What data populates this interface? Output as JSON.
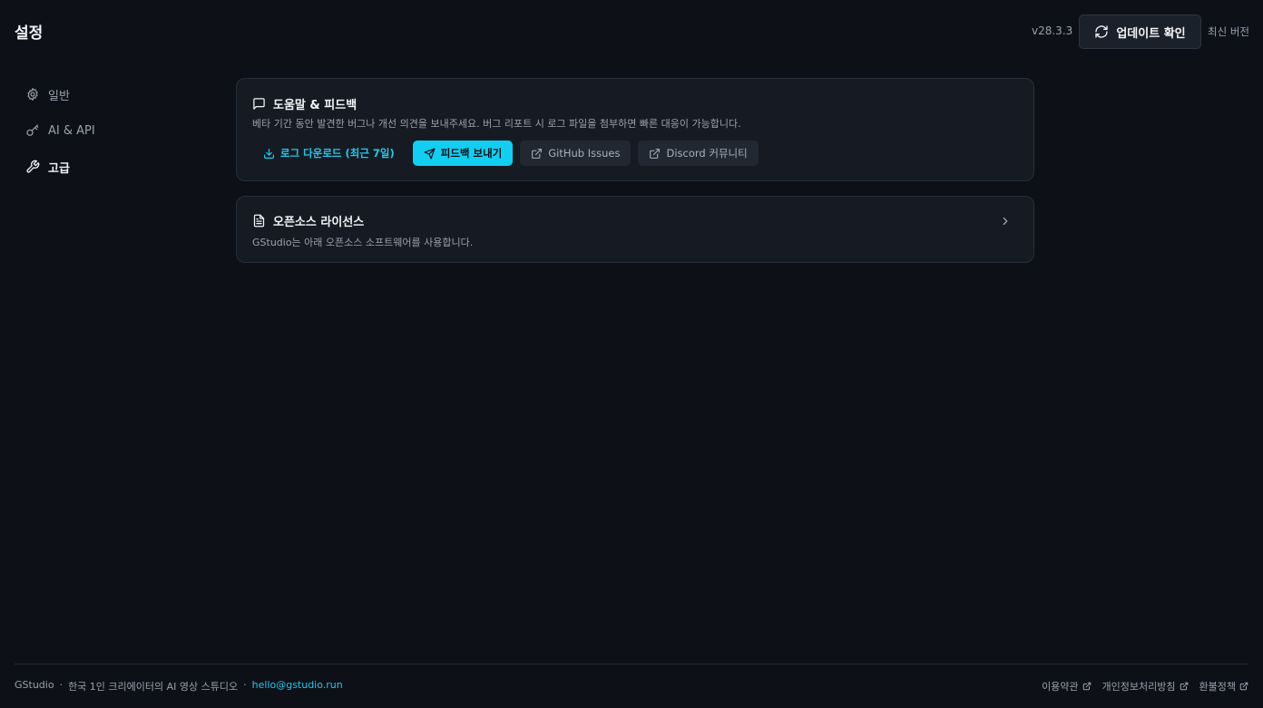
{
  "header": {
    "title": "설정",
    "version": "v28.3.3",
    "update_button": "업데이트 확인",
    "status": "최신 버전"
  },
  "sidebar": {
    "items": [
      {
        "label": "일반",
        "icon": "gear-icon"
      },
      {
        "label": "AI & API",
        "icon": "key-icon"
      },
      {
        "label": "고급",
        "icon": "wrench-icon",
        "active": true
      }
    ]
  },
  "help_card": {
    "title": "도움말 & 피드백",
    "description": "베타 기간 동안 발견한 버그나 개선 의견을 보내주세요. 버그 리포트 시 로그 파일을 첨부하면 빠른 대응이 가능합니다.",
    "buttons": {
      "download_logs": "로그 다운로드 (최근 7일)",
      "send_feedback": "피드백 보내기",
      "github": "GitHub Issues",
      "discord": "Discord 커뮤니티"
    }
  },
  "license_card": {
    "title": "오픈소스 라이선스",
    "description": "GStudio는 아래 오픈소스 소프트웨어를 사용합니다."
  },
  "footer": {
    "brand": "GStudio",
    "sep1": "·",
    "tagline": "한국 1인 크리에이터의 AI 영상 스튜디오",
    "sep2": "·",
    "email": "hello@gstudio.run",
    "links": [
      "이용약관",
      "개인정보처리방침",
      "환불정책"
    ]
  },
  "colors": {
    "background": "#0d1017",
    "card": "#161b23",
    "accent": "#12cef0"
  }
}
